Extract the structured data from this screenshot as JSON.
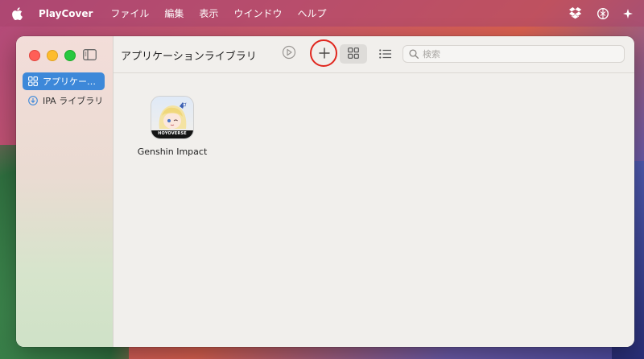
{
  "menubar": {
    "app_name": "PlayCover",
    "items": [
      "ファイル",
      "編集",
      "表示",
      "ウインドウ",
      "ヘルプ"
    ]
  },
  "sidebar": {
    "items": [
      {
        "label": "アプリケー…",
        "icon": "grid-icon",
        "active": true
      },
      {
        "label": "IPA ライブラリ",
        "icon": "download-circle-icon",
        "active": false
      }
    ]
  },
  "toolbar": {
    "title": "アプリケーションライブラリ",
    "search_placeholder": "検索"
  },
  "apps": [
    {
      "name": "Genshin Impact",
      "icon_text": "HOYOVERSE"
    }
  ],
  "colors": {
    "accent": "#3d88d9",
    "highlight_circle": "#e0261e"
  }
}
